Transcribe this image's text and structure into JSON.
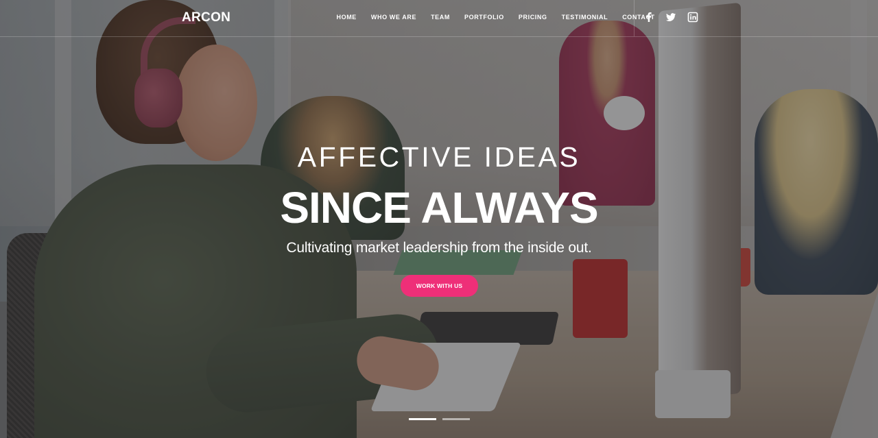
{
  "brand": {
    "name": "ARCON"
  },
  "nav": {
    "items": [
      {
        "label": "HOME"
      },
      {
        "label": "WHO WE ARE"
      },
      {
        "label": "TEAM"
      },
      {
        "label": "PORTFOLIO"
      },
      {
        "label": "PRICING"
      },
      {
        "label": "TESTIMONIAL"
      },
      {
        "label": "CONTACT"
      }
    ]
  },
  "social": [
    {
      "icon": "facebook-icon"
    },
    {
      "icon": "twitter-icon"
    },
    {
      "icon": "linkedin-icon"
    }
  ],
  "hero": {
    "kicker": "AFFECTIVE IDEAS",
    "title": "SINCE ALWAYS",
    "subtitle": "Cultivating market leadership from the inside out.",
    "cta_label": "WORK WITH US",
    "cta_color": "#ee2f78"
  },
  "slider": {
    "slides": 2,
    "active": 1
  }
}
